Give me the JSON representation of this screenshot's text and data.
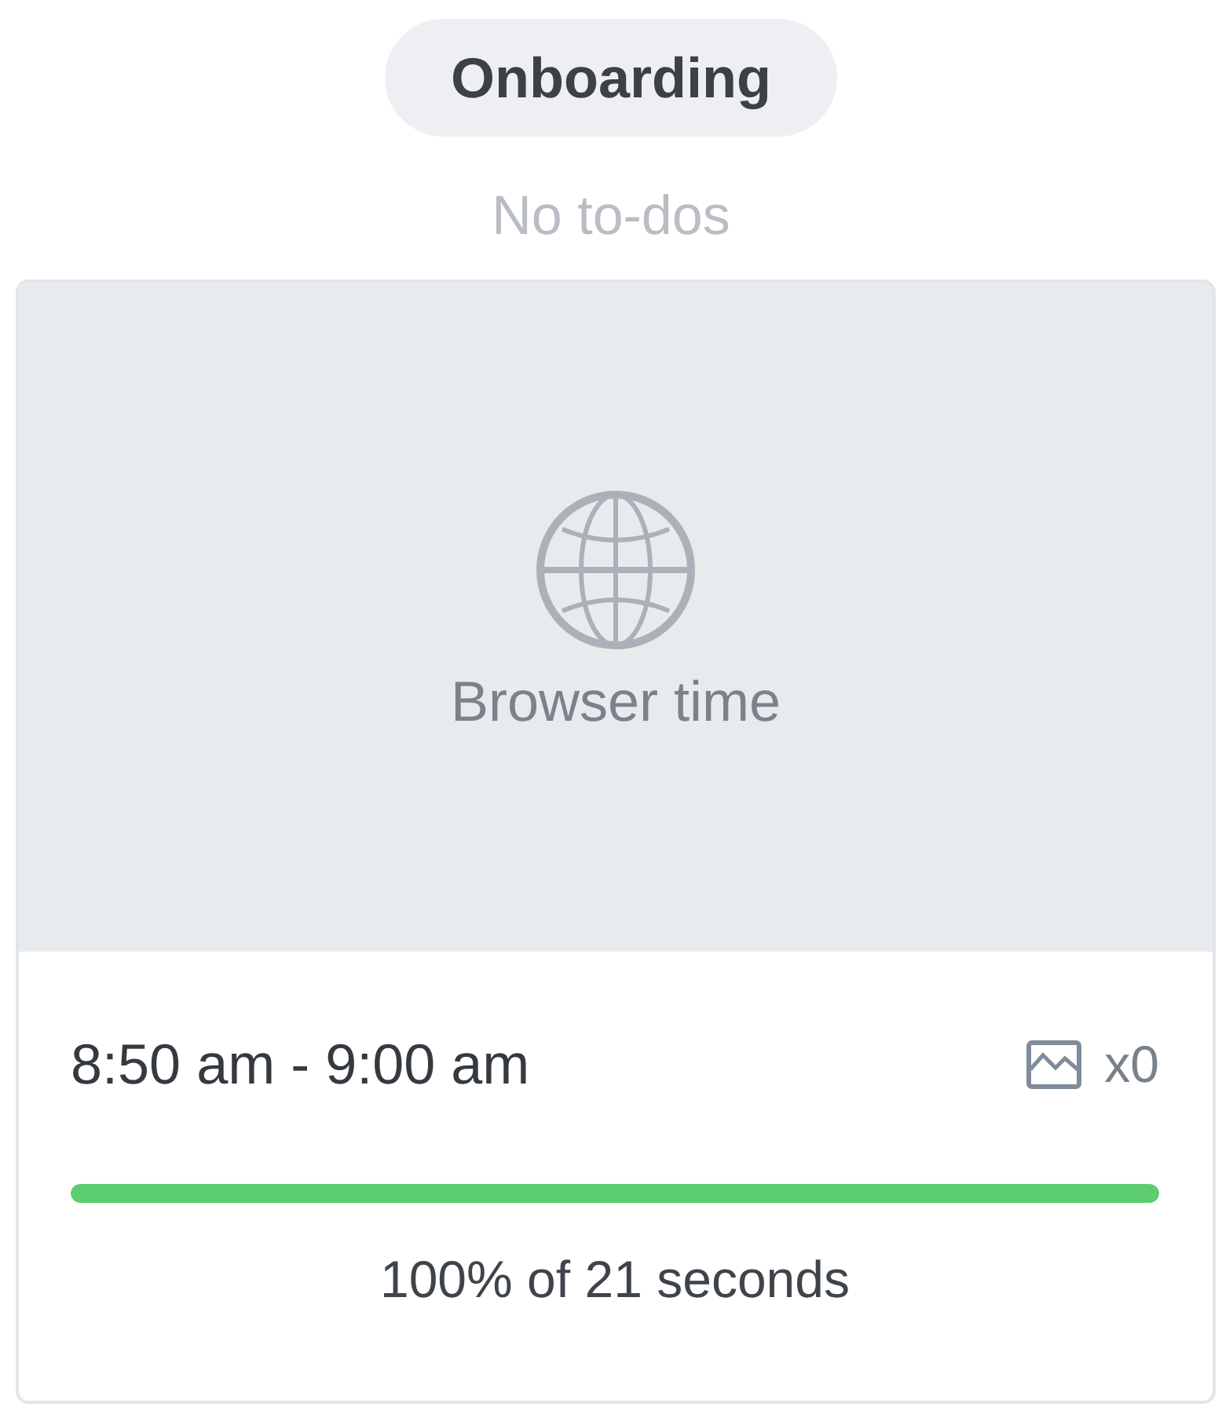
{
  "group": {
    "label": "Onboarding"
  },
  "todos": {
    "empty_text": "No to-dos"
  },
  "card": {
    "preview": {
      "kind": "browser",
      "label": "Browser time"
    },
    "time_range": "8:50 am - 9:00 am",
    "screenshots": {
      "count": "x0"
    },
    "progress": {
      "level": 1,
      "caption": "100% of 21 seconds"
    }
  }
}
